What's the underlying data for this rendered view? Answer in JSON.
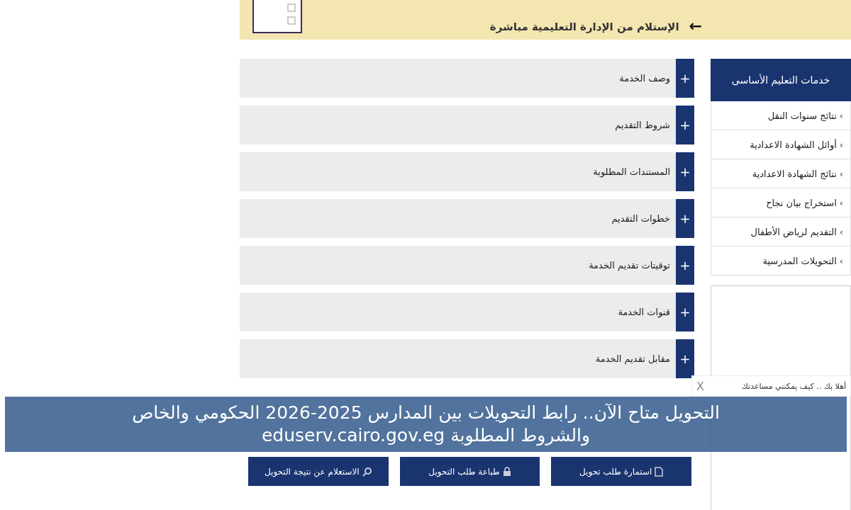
{
  "top_banner": {
    "arrow": "←",
    "text": "الإستلام من الإدارة التعليمية مباشرة"
  },
  "accordion": [
    {
      "label": "وصف الخدمة",
      "toggle": "+",
      "expanded": false
    },
    {
      "label": "شروط التقديم",
      "toggle": "+",
      "expanded": false
    },
    {
      "label": "المستندات المطلوبة",
      "toggle": "+",
      "expanded": false
    },
    {
      "label": "خطوات التقديم",
      "toggle": "+",
      "expanded": false
    },
    {
      "label": "توقيتات تقديم الخدمة",
      "toggle": "+",
      "expanded": false
    },
    {
      "label": "قنوات الخدمة",
      "toggle": "+",
      "expanded": false
    },
    {
      "label": "مقابل تقديم الخدمة",
      "toggle": "+",
      "expanded": false
    }
  ],
  "sidebar": {
    "title": "خدمات التعليم الأساسى",
    "items": [
      {
        "label": "نتائج سنوات النقل",
        "chevron": "›"
      },
      {
        "label": "أوائل الشهادة الاعدادية",
        "chevron": "›"
      },
      {
        "label": "نتائج الشهادة الاعدادية",
        "chevron": "›"
      },
      {
        "label": "استخراج بيان نجاح",
        "chevron": "›"
      },
      {
        "label": "التقديم لرياض الأطفال",
        "chevron": "›"
      },
      {
        "label": "التحويلات المدرسية",
        "chevron": "›"
      }
    ]
  },
  "action_buttons": [
    {
      "label": "استمارة طلب تحويل",
      "kind": "document"
    },
    {
      "label": "طباعة طلب التحويل",
      "kind": "lock"
    },
    {
      "label": "الاستعلام عن نتيجة التحويل",
      "kind": "search"
    }
  ],
  "chat": {
    "message": "أهلا بك .. كيف يمكنني مساعدتك",
    "close": "X"
  },
  "caption": {
    "line_1": "التحويل متاح الآن.. رابط التحويلات بين المدارس 2025-2026 الحكومي والخاص",
    "line_2": "والشروط المطلوبة eduserv.cairo.gov.eg"
  }
}
